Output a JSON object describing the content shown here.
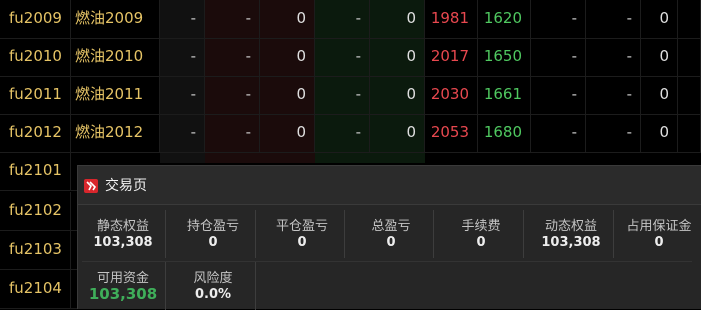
{
  "quote_rows": [
    {
      "code": "fu2009",
      "name": "燃油2009",
      "cols": [
        "-",
        "-",
        "0",
        "-",
        "0",
        "1981",
        "1620",
        "-",
        "-",
        "0",
        ""
      ]
    },
    {
      "code": "fu2010",
      "name": "燃油2010",
      "cols": [
        "-",
        "-",
        "0",
        "-",
        "0",
        "2017",
        "1650",
        "-",
        "-",
        "0",
        ""
      ]
    },
    {
      "code": "fu2011",
      "name": "燃油2011",
      "cols": [
        "-",
        "-",
        "0",
        "-",
        "0",
        "2030",
        "1661",
        "-",
        "-",
        "0",
        ""
      ]
    },
    {
      "code": "fu2012",
      "name": "燃油2012",
      "cols": [
        "-",
        "-",
        "0",
        "-",
        "0",
        "2053",
        "1680",
        "-",
        "-",
        "0",
        ""
      ]
    },
    {
      "code": "fu2101",
      "name": "",
      "cols": [
        "",
        "",
        "",
        "",
        "",
        "",
        "",
        "",
        "",
        "",
        ""
      ]
    },
    {
      "code": "fu2102",
      "name": "",
      "cols": [
        "",
        "",
        "",
        "",
        "",
        "",
        "",
        "",
        "",
        "",
        ""
      ]
    },
    {
      "code": "fu2103",
      "name": "",
      "cols": [
        "",
        "",
        "",
        "",
        "",
        "",
        "",
        "",
        "",
        "",
        ""
      ]
    },
    {
      "code": "fu2104",
      "name": "",
      "cols": [
        "",
        "",
        "",
        "",
        "",
        "",
        "",
        "",
        "",
        "",
        ""
      ]
    }
  ],
  "trade_panel": {
    "title": "交易页",
    "icon": "trade-logo-icon",
    "stats_row1": [
      {
        "label": "静态权益",
        "value": "103,308"
      },
      {
        "label": "持仓盈亏",
        "value": "0"
      },
      {
        "label": "平仓盈亏",
        "value": "0"
      },
      {
        "label": "总盈亏",
        "value": "0"
      },
      {
        "label": "手续费",
        "value": "0"
      },
      {
        "label": "动态权益",
        "value": "103,308"
      },
      {
        "label": "占用保证金",
        "value": "0"
      }
    ],
    "stats_row2": [
      {
        "label": "可用资金",
        "value": "103,308"
      },
      {
        "label": "风险度",
        "value": "0.0%"
      }
    ]
  },
  "colors": {
    "background": "#000000",
    "code_text": "#e6c466",
    "price_up": "#e8484f",
    "price_down": "#4fc860",
    "available_funds": "#3fae5a",
    "panel_bg": "#262626",
    "logo": "#d8262c"
  }
}
